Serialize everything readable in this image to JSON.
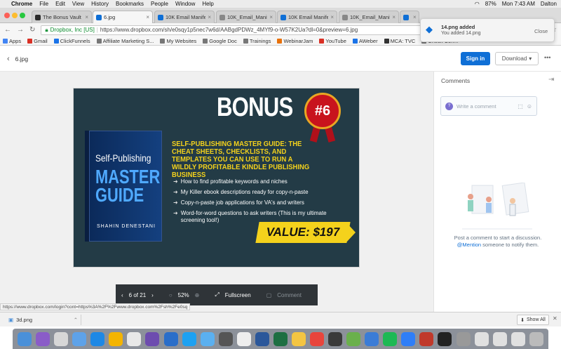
{
  "menubar": {
    "app": "Chrome",
    "items": [
      "File",
      "Edit",
      "View",
      "History",
      "Bookmarks",
      "People",
      "Window",
      "Help"
    ],
    "battery": "87%",
    "clock": "Mon 7:43 AM",
    "user": "Dalton"
  },
  "tabs": [
    {
      "title": "The Bonus Vault",
      "favcolor": "#2b2b2b"
    },
    {
      "title": "6.jpg",
      "favcolor": "#0f6fd6",
      "active": true
    },
    {
      "title": "10K Email Manife...",
      "favcolor": "#0f6fd6"
    },
    {
      "title": "10K_Email_Manife...",
      "favcolor": "#888888"
    },
    {
      "title": "10K Email Manife...",
      "favcolor": "#0f6fd6"
    },
    {
      "title": "10K_Email_Manife...",
      "favcolor": "#888888"
    },
    {
      "title": "7...",
      "favcolor": "#0f6fd6"
    }
  ],
  "address": {
    "secure_label": "Dropbox, Inc [US]",
    "url": "https://www.dropbox.com/sh/e0sqy1p5nec7w6d/AABgdPDWz_4MYf9-o-W57K2Ua?dl=0&preview=6.jpg"
  },
  "bookmarks": [
    {
      "label": "Apps",
      "color": "#4285f4"
    },
    {
      "label": "Gmail",
      "color": "#d93025"
    },
    {
      "label": "ClickFunnels",
      "color": "#1a73e8"
    },
    {
      "label": "Affiliate Marketing S...",
      "color": "#777777"
    },
    {
      "label": "My Websites",
      "color": "#777777"
    },
    {
      "label": "Google Doc",
      "color": "#777777"
    },
    {
      "label": "Trainings",
      "color": "#777777"
    },
    {
      "label": "WebinarJam",
      "color": "#e8710a"
    },
    {
      "label": "YouTube",
      "color": "#d93025"
    },
    {
      "label": "AWeber",
      "color": "#1a73e8"
    },
    {
      "label": "MCA: TVC",
      "color": "#333333"
    },
    {
      "label": "Check Con...",
      "color": "#777777"
    }
  ],
  "header": {
    "filename": "6.jpg",
    "signin": "Sign in",
    "download": "Download"
  },
  "image": {
    "title": "BONUS",
    "badge": "#6",
    "headline": "SELF-PUBLISHING MASTER GUIDE: THE CHEAT SHEETS, CHECKLISTS, AND TEMPLATES YOU CAN USE TO RUN A WILDLY PROFITABLE KINDLE PUBLISHING BUSINESS",
    "bullets": [
      "How to find profitable keywords and niches",
      "My Killer ebook descriptions ready for copy-n-paste",
      "Copy-n-paste job applications for VA's and writers",
      "Word-for-word questions to ask writers (This is my ultimate screening tool!)"
    ],
    "value": "VALUE: $197",
    "book_line1": "Self-Publishing",
    "book_line2": "MASTER GUIDE",
    "book_author": "SHAHIN DENESTANI"
  },
  "viewer": {
    "page": "6 of 21",
    "zoom": "52%",
    "fullscreen": "Fullscreen",
    "comment": "Comment"
  },
  "comments": {
    "title": "Comments",
    "avatar": "?",
    "placeholder": "Write a comment",
    "empty_text": "Post a comment to start a discussion.",
    "mention": "@Mention",
    "mention_rest": "someone to notify them."
  },
  "statusbar": {
    "url": "https://www.dropbox.com/login?cont=https%3A%2F%2Fwww.dropbox.com%2Fsh%2Fe0sq"
  },
  "downloads": {
    "file": "3d.png",
    "show_all": "Show All"
  },
  "notification": {
    "title": "14.png added",
    "body": "You added 14.png",
    "close": "Close"
  },
  "dock_colors": [
    "#4a90d9",
    "#8a5cc8",
    "#d7d7d7",
    "#5ea2e8",
    "#1e88e5",
    "#f4b400",
    "#e8e8e8",
    "#6d4caf",
    "#2a6ec9",
    "#1da1f2",
    "#5bb0f0",
    "#555555",
    "#eeeeee",
    "#2b579a",
    "#1d6f42",
    "#f4c542",
    "#e8453c",
    "#3a3a3a",
    "#6ab04c",
    "#3b7cd6",
    "#1db954",
    "#2f7ef7",
    "#c0392b",
    "#222222",
    "#999999",
    "#e0e0e0",
    "#e0e0e0",
    "#e0e0e0",
    "#bbbbbb"
  ]
}
